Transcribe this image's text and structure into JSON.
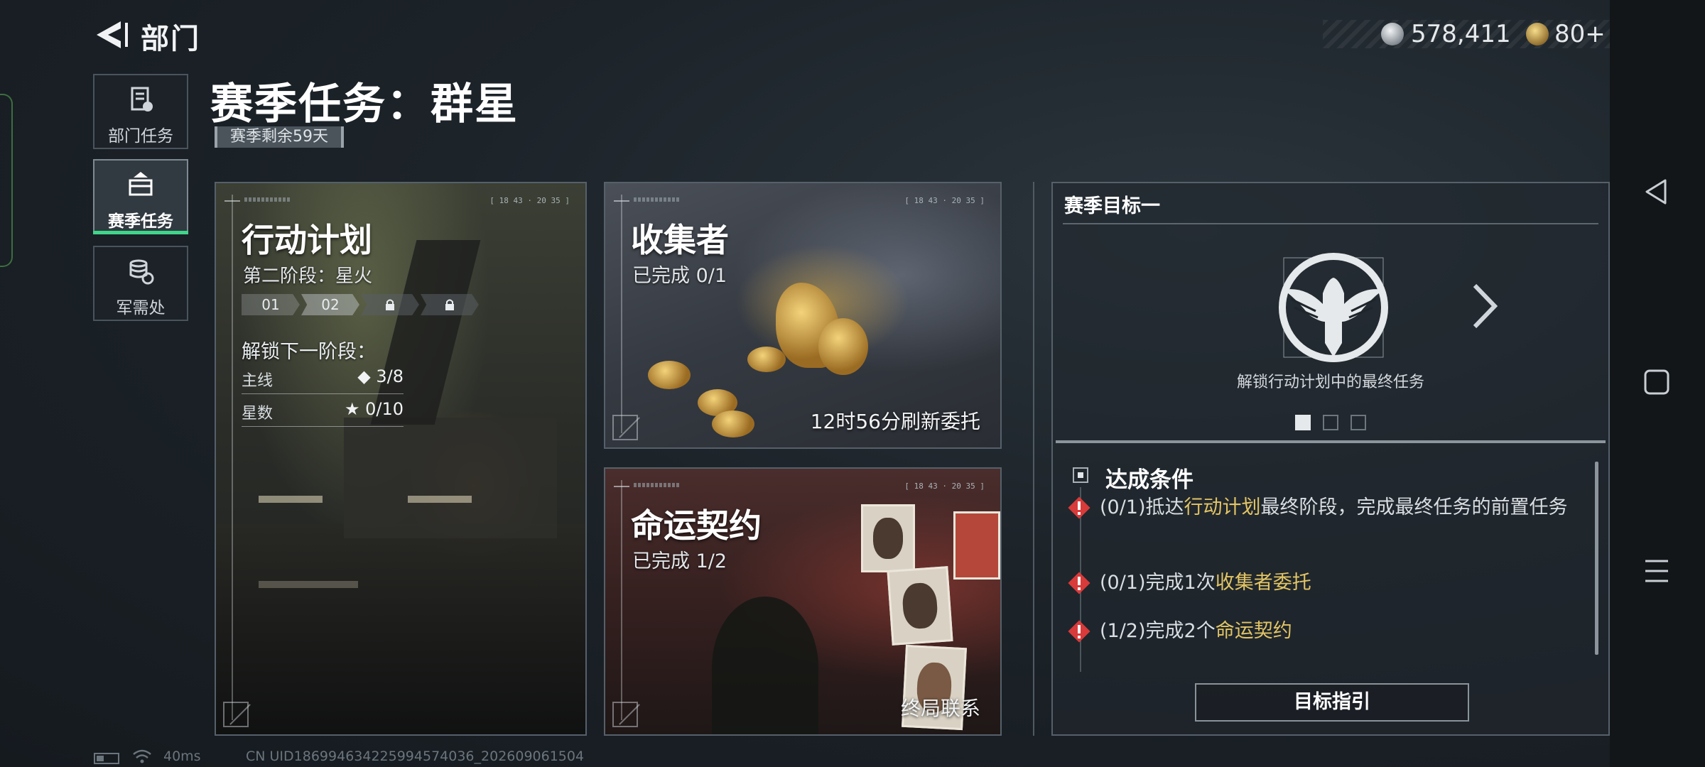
{
  "header": {
    "back_label": "部门",
    "currency": [
      {
        "icon": "silver-coin-icon",
        "value": "578,411"
      },
      {
        "icon": "gold-coin-icon",
        "value": "80+"
      }
    ]
  },
  "nav": [
    {
      "label": "部门任务",
      "icon": "document-icon",
      "active": false
    },
    {
      "label": "赛季任务",
      "icon": "briefcase-icon",
      "active": true
    },
    {
      "label": "军需处",
      "icon": "coin-stack-icon",
      "active": false
    }
  ],
  "season": {
    "title": "赛季任务：群星",
    "remaining": "赛季剩余59天"
  },
  "cards": {
    "plan": {
      "title": "行动计划",
      "phase": "第二阶段：星火",
      "stages": [
        "01",
        "02"
      ],
      "unlock_label": "解锁下一阶段：",
      "rows": [
        {
          "key": "主线",
          "value": "◆ 3/8"
        },
        {
          "key": "星数",
          "value": "★ 0/10"
        }
      ],
      "timestamp": "[ 18 43 · 20 35 ]"
    },
    "collector": {
      "title": "收集者",
      "progress": "已完成 0/1",
      "footer": "12时56分刷新委托",
      "timestamp": "[ 18 43 · 20 35 ]"
    },
    "fate": {
      "title": "命运契约",
      "progress": "已完成 1/2",
      "footer": "终局联系",
      "timestamp": "[ 18 43 · 20 35 ]"
    }
  },
  "panel": {
    "title": "赛季目标一",
    "unlock_text": "解锁行动计划中的最终任务",
    "emblem_icon": "eagle-emblem-icon",
    "page_count": 3,
    "page_active": 1,
    "conditions_header": "达成条件",
    "conditions": [
      {
        "prefix": "(0/1)抵达",
        "highlight": "行动计划",
        "suffix": "最终阶段，完成最终任务的前置任务"
      },
      {
        "prefix": "(0/1)完成1次",
        "highlight": "收集者委托",
        "suffix": ""
      },
      {
        "prefix": "(1/2)完成2个",
        "highlight": "命运契约",
        "suffix": ""
      }
    ],
    "guide_button": "目标指引"
  },
  "footer": {
    "ping": "40ms",
    "uid": "CN UID18699463422599457403​6_202609061504"
  },
  "colors": {
    "accent_green": "#3fd68a",
    "highlight_yellow": "#e3c565",
    "warning_red": "#d93a3a"
  }
}
